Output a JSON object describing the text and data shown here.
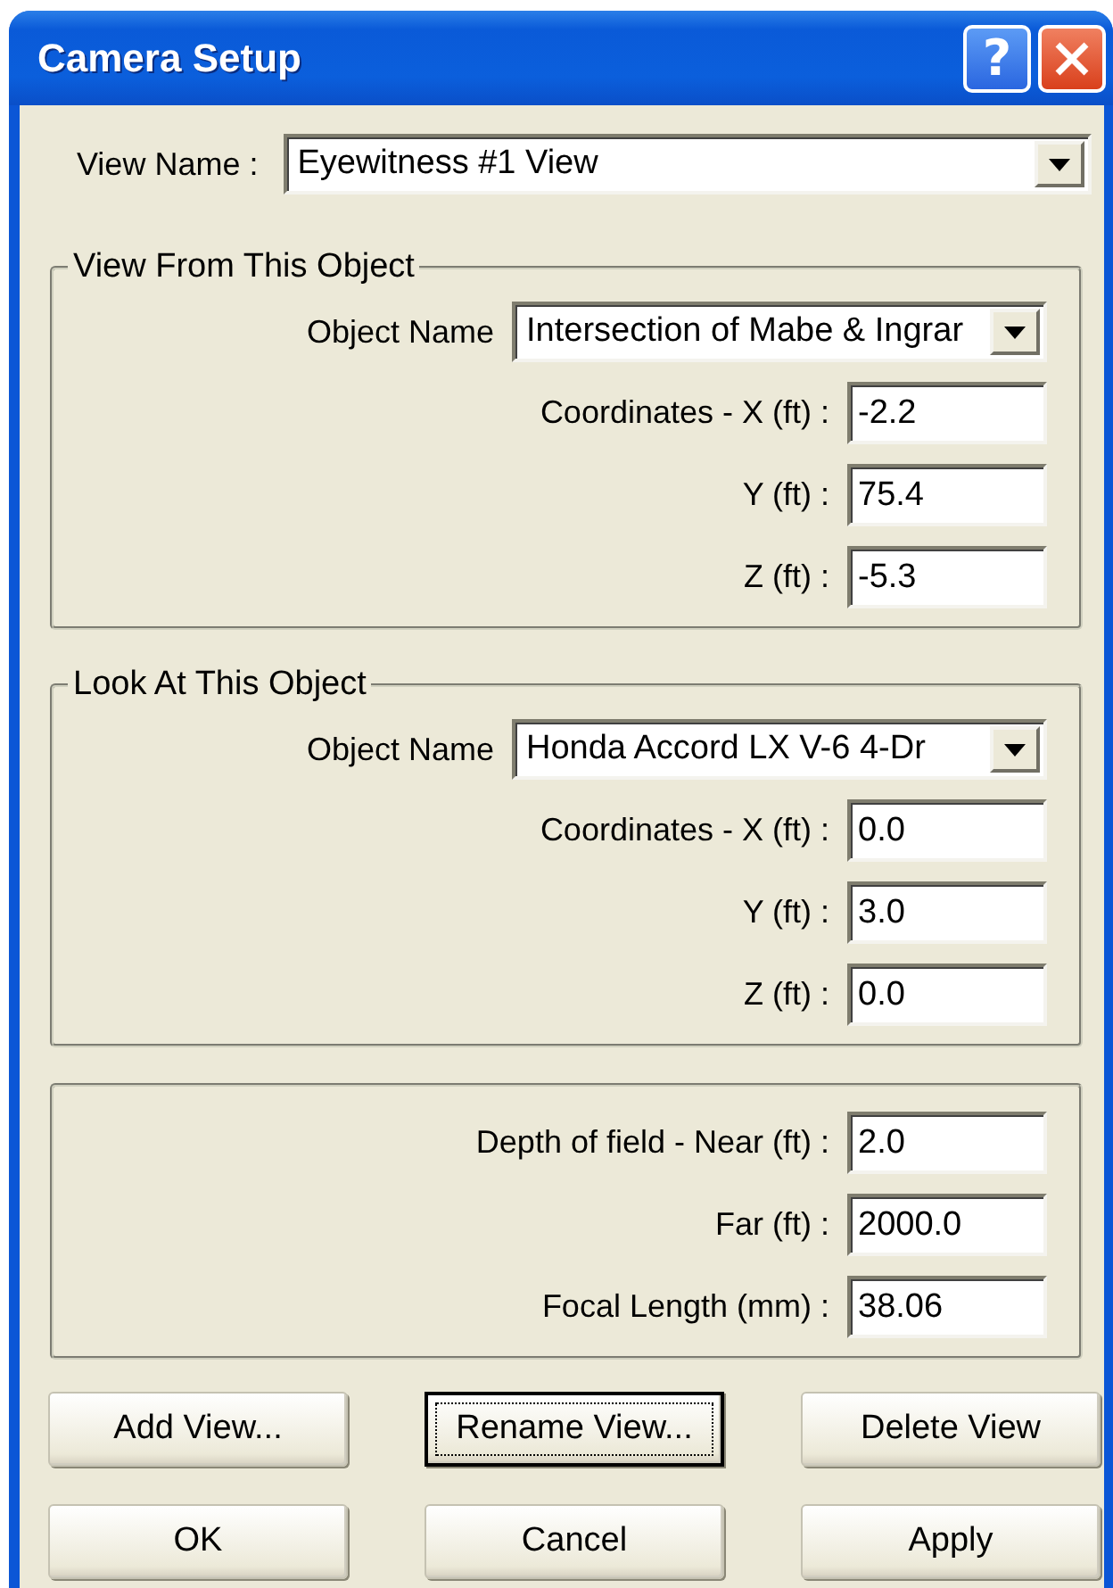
{
  "window": {
    "title": "Camera Setup",
    "help_button": "?"
  },
  "view_name": {
    "label": "View Name :",
    "value": "Eyewitness #1 View"
  },
  "groups": [
    {
      "legend": "View From This Object",
      "object": {
        "label": "Object Name",
        "value": "Intersection of Mabe & Ingrar"
      },
      "fields": [
        {
          "label": "Coordinates - X (ft) :",
          "value": "-2.2"
        },
        {
          "label": "Y (ft) :",
          "value": "75.4"
        },
        {
          "label": "Z (ft) :",
          "value": "-5.3"
        }
      ]
    },
    {
      "legend": "Look At This Object",
      "object": {
        "label": "Object Name",
        "value": "Honda Accord LX V-6 4-Dr"
      },
      "fields": [
        {
          "label": "Coordinates - X (ft) :",
          "value": "0.0"
        },
        {
          "label": "Y (ft) :",
          "value": "3.0"
        },
        {
          "label": "Z (ft) :",
          "value": "0.0"
        }
      ]
    },
    {
      "fields": [
        {
          "label": "Depth of field - Near (ft) :",
          "value": "2.0"
        },
        {
          "label": "Far (ft) :",
          "value": "2000.0"
        },
        {
          "label": "Focal Length (mm) :",
          "value": "38.06"
        }
      ]
    }
  ],
  "buttons": [
    {
      "label": "Add View...",
      "focused": false
    },
    {
      "label": "Rename View...",
      "focused": true
    },
    {
      "label": "Delete View",
      "focused": false
    },
    {
      "label": "OK",
      "focused": false
    },
    {
      "label": "Cancel",
      "focused": false
    },
    {
      "label": "Apply",
      "focused": false
    }
  ]
}
